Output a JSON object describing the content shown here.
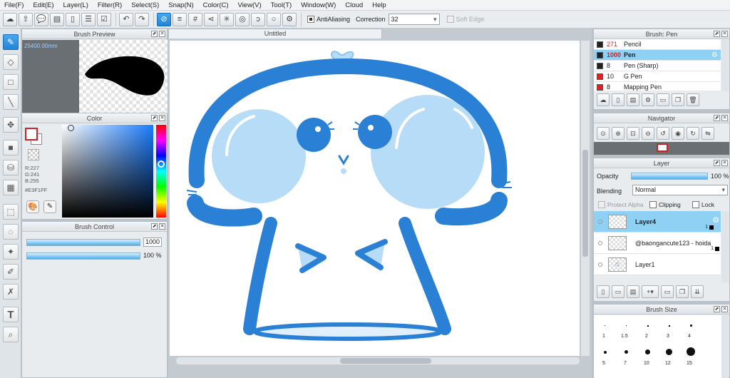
{
  "menu": [
    "File(F)",
    "Edit(E)",
    "Layer(L)",
    "Filter(R)",
    "Select(S)",
    "Snap(N)",
    "Color(C)",
    "View(V)",
    "Tool(T)",
    "Window(W)",
    "Cloud",
    "Help"
  ],
  "toolbar": {
    "antialiasing_label": "AntiAliasing",
    "correction_label": "Correction",
    "correction_value": "32",
    "soft_edge_label": "Soft Edge"
  },
  "brush_preview": {
    "title": "Brush Preview",
    "size_text": "25400.00mm"
  },
  "color_panel": {
    "title": "Color",
    "r": "R:227",
    "g": "G:241",
    "b": "B:255",
    "hex": "#E3F1FF",
    "primary_color": "#ffffff",
    "accent": "#cc2222"
  },
  "brush_control": {
    "title": "Brush Control",
    "size_value": "1000",
    "opacity_value": "100 %",
    "size_fraction": 1.0,
    "opacity_fraction": 1.0
  },
  "document": {
    "tab_title": "Untitled"
  },
  "brush_list": {
    "title": "Brush: Pen",
    "items": [
      {
        "size": "271",
        "name": "Pencil",
        "color": "#222222"
      },
      {
        "size": "1000",
        "name": "Pen",
        "color": "#222222"
      },
      {
        "size": "8",
        "name": "Pen (Sharp)",
        "color": "#222222"
      },
      {
        "size": "10",
        "name": "G Pen",
        "color": "#dd2222"
      },
      {
        "size": "8",
        "name": "Mapping Pen",
        "color": "#dd2222"
      }
    ]
  },
  "navigator": {
    "title": "Navigator"
  },
  "layer_panel": {
    "title": "Layer",
    "opacity_label": "Opacity",
    "opacity_value": "100 %",
    "blending_label": "Blending",
    "blending_value": "Normal",
    "protect_alpha_label": "Protect Alpha",
    "clipping_label": "Clipping",
    "lock_label": "Lock",
    "layers": [
      {
        "name": "Layer4",
        "num": "1"
      },
      {
        "name": "@baongancute123 - hoida",
        "num": "1"
      },
      {
        "name": "Layer1",
        "num": ""
      }
    ]
  },
  "brush_size": {
    "title": "Brush Size",
    "row1": [
      "1",
      "1.5",
      "2",
      "3",
      "4"
    ],
    "row2": [
      "5",
      "7",
      "10",
      "12",
      "15"
    ]
  },
  "colors": {
    "accent_blue": "#2a80d4",
    "light_blue": "#b7dcf7",
    "selected_row": "#8fd0f5"
  }
}
